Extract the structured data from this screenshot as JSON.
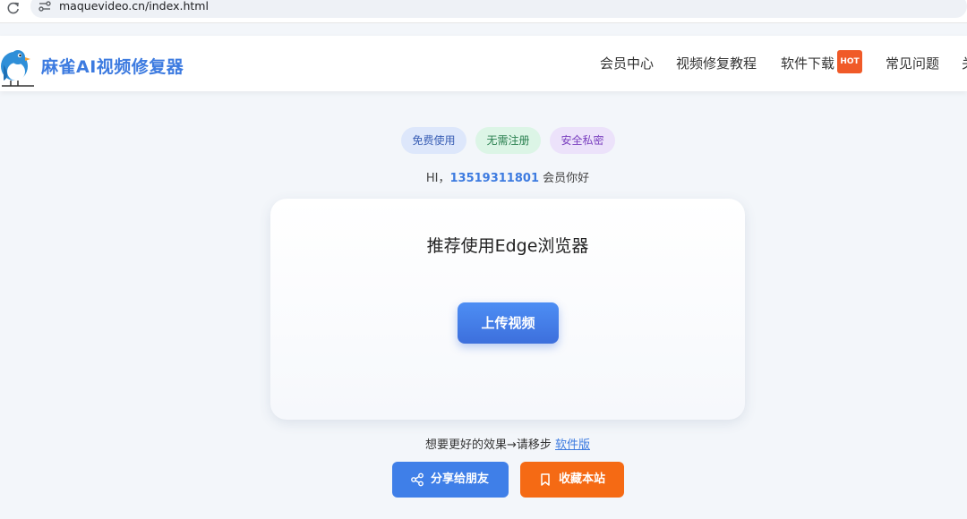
{
  "browser": {
    "url": "maquevideo.cn/index.html"
  },
  "header": {
    "brand": "麻雀AI视频修复器",
    "nav": [
      {
        "label": "会员中心"
      },
      {
        "label": "视频修复教程"
      },
      {
        "label": "软件下载",
        "badge": "HOT"
      },
      {
        "label": "常见问题"
      },
      {
        "label": "关"
      }
    ]
  },
  "tags": [
    {
      "label": "免费使用"
    },
    {
      "label": "无需注册"
    },
    {
      "label": "安全私密"
    }
  ],
  "greeting": {
    "prefix": "HI，",
    "phone": "13519311801",
    "suffix": " 会员你好"
  },
  "card": {
    "title": "推荐使用Edge浏览器",
    "upload_label": "上传视频"
  },
  "hint": {
    "text": "想要更好的效果→请移步 ",
    "link": "软件版"
  },
  "actions": {
    "share_label": "分享给朋友",
    "favorite_label": "收藏本站"
  },
  "colors": {
    "brand": "#3d7be0",
    "share_button": "#3f7fe8",
    "favorite_button": "#f56a14",
    "hot_badge": "#f05a28"
  },
  "icons": {
    "reload": "reload-icon",
    "site_info": "site-info-icon",
    "logo": "bird-logo-icon",
    "share": "share-icon",
    "bookmark": "bookmark-icon"
  }
}
